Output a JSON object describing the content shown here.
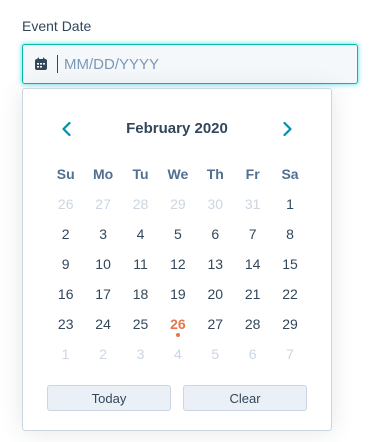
{
  "field": {
    "label": "Event Date",
    "value": "",
    "placeholder": "MM/DD/YYYY"
  },
  "calendar": {
    "month_title": "February 2020",
    "weekdays": [
      "Su",
      "Mo",
      "Tu",
      "We",
      "Th",
      "Fr",
      "Sa"
    ],
    "weeks": [
      [
        {
          "d": "26",
          "m": true
        },
        {
          "d": "27",
          "m": true
        },
        {
          "d": "28",
          "m": true
        },
        {
          "d": "29",
          "m": true
        },
        {
          "d": "30",
          "m": true
        },
        {
          "d": "31",
          "m": true
        },
        {
          "d": "1",
          "m": false
        }
      ],
      [
        {
          "d": "2",
          "m": false
        },
        {
          "d": "3",
          "m": false
        },
        {
          "d": "4",
          "m": false
        },
        {
          "d": "5",
          "m": false
        },
        {
          "d": "6",
          "m": false
        },
        {
          "d": "7",
          "m": false
        },
        {
          "d": "8",
          "m": false
        }
      ],
      [
        {
          "d": "9",
          "m": false
        },
        {
          "d": "10",
          "m": false
        },
        {
          "d": "11",
          "m": false
        },
        {
          "d": "12",
          "m": false
        },
        {
          "d": "13",
          "m": false
        },
        {
          "d": "14",
          "m": false
        },
        {
          "d": "15",
          "m": false
        }
      ],
      [
        {
          "d": "16",
          "m": false
        },
        {
          "d": "17",
          "m": false
        },
        {
          "d": "18",
          "m": false
        },
        {
          "d": "19",
          "m": false
        },
        {
          "d": "20",
          "m": false
        },
        {
          "d": "21",
          "m": false
        },
        {
          "d": "22",
          "m": false
        }
      ],
      [
        {
          "d": "23",
          "m": false
        },
        {
          "d": "24",
          "m": false
        },
        {
          "d": "25",
          "m": false
        },
        {
          "d": "26",
          "m": false,
          "today": true
        },
        {
          "d": "27",
          "m": false
        },
        {
          "d": "28",
          "m": false
        },
        {
          "d": "29",
          "m": false
        }
      ],
      [
        {
          "d": "1",
          "m": true
        },
        {
          "d": "2",
          "m": true
        },
        {
          "d": "3",
          "m": true
        },
        {
          "d": "4",
          "m": true
        },
        {
          "d": "5",
          "m": true
        },
        {
          "d": "6",
          "m": true
        },
        {
          "d": "7",
          "m": true
        }
      ]
    ],
    "today_button": "Today",
    "clear_button": "Clear"
  },
  "icons": {
    "field_icon": "calendar-icon",
    "prev": "chevron-left-icon",
    "next": "chevron-right-icon"
  },
  "colors": {
    "accent_focus": "#00bda5",
    "text": "#33475b",
    "muted": "#cbd6e2",
    "today": "#e5764a",
    "nav": "#0091ae"
  }
}
